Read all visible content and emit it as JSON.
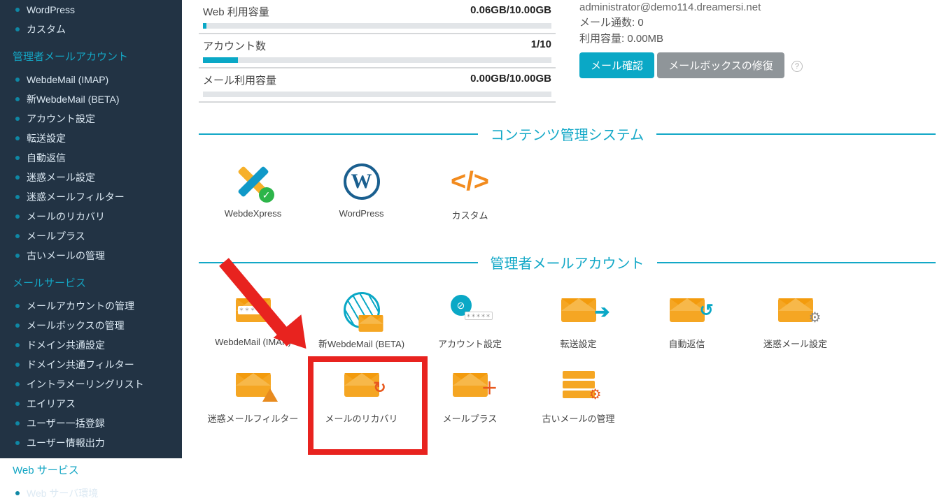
{
  "sidebar": {
    "group0_items": [
      {
        "label": "WordPress"
      },
      {
        "label": "カスタム"
      }
    ],
    "group1": {
      "heading": "管理者メールアカウント",
      "items": [
        {
          "label": "WebdeMail (IMAP)"
        },
        {
          "label": "新WebdeMail (BETA)"
        },
        {
          "label": "アカウント設定"
        },
        {
          "label": "転送設定"
        },
        {
          "label": "自動返信"
        },
        {
          "label": "迷惑メール設定"
        },
        {
          "label": "迷惑メールフィルター"
        },
        {
          "label": "メールのリカバリ"
        },
        {
          "label": "メールプラス"
        },
        {
          "label": "古いメールの管理"
        }
      ]
    },
    "group2": {
      "heading": "メールサービス",
      "items": [
        {
          "label": "メールアカウントの管理"
        },
        {
          "label": "メールボックスの管理"
        },
        {
          "label": "ドメイン共通設定"
        },
        {
          "label": "ドメイン共通フィルター"
        },
        {
          "label": "イントラメーリングリスト"
        },
        {
          "label": "エイリアス"
        },
        {
          "label": "ユーザー一括登録"
        },
        {
          "label": "ユーザー情報出力"
        }
      ]
    },
    "group3": {
      "heading": "Web サービス",
      "items": [
        {
          "label": "Web サーバ環境"
        }
      ]
    }
  },
  "usage": {
    "rows": [
      {
        "label": "Web 利用容量",
        "value": "0.06GB/10.00GB",
        "pct": 1
      },
      {
        "label": "アカウント数",
        "value": "1/10",
        "pct": 10
      },
      {
        "label": "メール利用容量",
        "value": "0.00GB/10.00GB",
        "pct": 0
      }
    ]
  },
  "mailbox": {
    "email": "administrator@demo114.dreamersi.net",
    "count_label": "メール通数:",
    "count_value": "0",
    "size_label": "利用容量:",
    "size_value": "0.00MB",
    "btn_check": "メール確認",
    "btn_repair": "メールボックスの修復"
  },
  "sections": {
    "cms": {
      "title": "コンテンツ管理システム",
      "tiles": [
        {
          "label": "WebdeXpress",
          "icon": "webdexpress-icon"
        },
        {
          "label": "WordPress",
          "icon": "wordpress-icon"
        },
        {
          "label": "カスタム",
          "icon": "custom-code-icon"
        }
      ]
    },
    "mail": {
      "title": "管理者メールアカウント",
      "tiles": [
        {
          "label": "WebdeMail (IMAP)",
          "icon": "mail-imap-icon"
        },
        {
          "label": "新WebdeMail (BETA)",
          "icon": "mail-globe-icon"
        },
        {
          "label": "アカウント設定",
          "icon": "account-key-icon"
        },
        {
          "label": "転送設定",
          "icon": "mail-forward-icon"
        },
        {
          "label": "自動返信",
          "icon": "mail-autoreply-icon"
        },
        {
          "label": "迷惑メール設定",
          "icon": "mail-spam-settings-icon"
        },
        {
          "label": "迷惑メールフィルター",
          "icon": "mail-spam-filter-icon"
        },
        {
          "label": "メールのリカバリ",
          "icon": "mail-recovery-icon"
        },
        {
          "label": "メールプラス",
          "icon": "mail-plus-icon"
        },
        {
          "label": "古いメールの管理",
          "icon": "mail-archive-icon"
        }
      ]
    }
  },
  "annotation": {
    "highlighted_tile_label": "メールのリカバリ"
  }
}
